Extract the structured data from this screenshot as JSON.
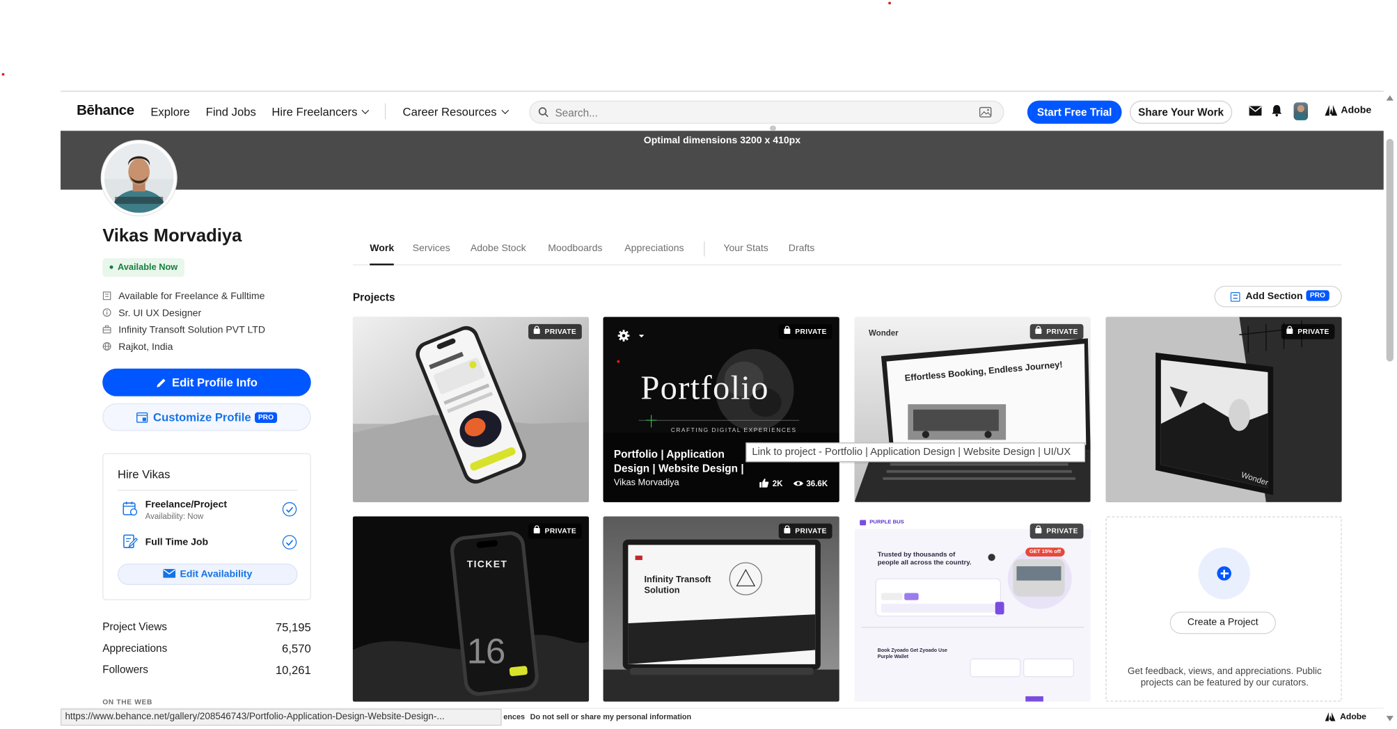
{
  "nav": {
    "logo": "Bēhance",
    "links": [
      "Explore",
      "Find Jobs",
      "Hire Freelancers",
      "Career Resources"
    ],
    "search_placeholder": "Search...",
    "start_trial": "Start Free Trial",
    "share_work": "Share Your Work",
    "adobe": "Adobe",
    "icons": [
      "mail-icon",
      "bell-icon",
      "user-avatar",
      "adobe-logo-icon"
    ]
  },
  "banner": {
    "text": "Optimal dimensions 3200 x 410px"
  },
  "profile": {
    "name": "Vikas Morvadiya",
    "availability": "Available Now",
    "info": [
      "Available for Freelance & Fulltime",
      "Sr. UI UX Designer",
      "Infinity Transoft Solution PVT LTD",
      "Rajkot, India"
    ],
    "edit_button": "Edit Profile Info",
    "customize_button": "Customize Profile",
    "pro": "PRO"
  },
  "hire": {
    "title": "Hire Vikas",
    "option1": "Freelance/Project",
    "option1_sub": "Availability: Now",
    "option2": "Full Time Job",
    "edit_button": "Edit Availability"
  },
  "stats": [
    {
      "label": "Project Views",
      "value": "75,195"
    },
    {
      "label": "Appreciations",
      "value": "6,570"
    },
    {
      "label": "Followers",
      "value": "10,261"
    }
  ],
  "on_the_web": "ON THE WEB",
  "tabs": [
    "Work",
    "Services",
    "Adobe Stock",
    "Moodboards",
    "Appreciations",
    "Your Stats",
    "Drafts"
  ],
  "active_tab": "Work",
  "projects_heading": "Projects",
  "add_section": "Add Section",
  "private_label": "PRIVATE",
  "featured_project": {
    "title": "Portfolio | Application Design | Website Design |",
    "author": "Vikas Morvadiya",
    "likes": "2K",
    "views": "36.6K",
    "art_title": "Portfolio",
    "art_subtitle": "CRAFTING DIGITAL EXPERIENCES"
  },
  "art_texts": {
    "wonder_headline": "Effortless Booking, Endless Journey!",
    "ticket": "TICKET",
    "big_number": "16",
    "infinity": "Infinity Transoft Solution",
    "purple_brand": "PURPLE BUS",
    "purple_headline": "Trusted by thousands of people all across the country.",
    "purple_offer": "GET 15% off",
    "purple_wallet": "Book Zyoado Get Zyoado Use Purple Wallet",
    "wonder_logo": "Wonder"
  },
  "tooltip": "Link to project - Portfolio | Application Design | Website Design | UI/UX",
  "create": {
    "button": "Create a Project",
    "description": "Get feedback, views, and appreciations. Public projects can be featured by our curators."
  },
  "footer": {
    "text_partial": "ences",
    "do_not_sell": "Do not sell or share my personal information",
    "adobe": "Adobe"
  },
  "status_url": "https://www.behance.net/gallery/208546743/Portfolio-Application-Design-Website-Design-..."
}
